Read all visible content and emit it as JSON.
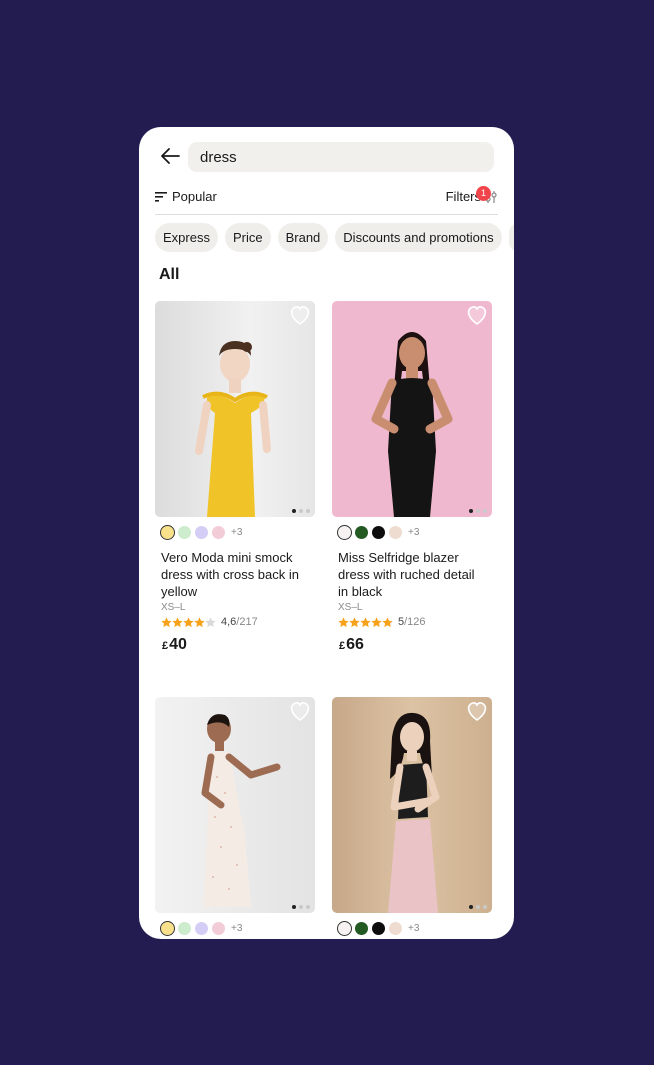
{
  "search": {
    "value": "dress",
    "placeholder": ""
  },
  "toolbar": {
    "sort_label": "Popular",
    "filters_label": "Filters",
    "filters_badge": "1"
  },
  "chips": [
    "Express",
    "Price",
    "Brand",
    "Discounts and promotions"
  ],
  "section_title": "All",
  "colors": {
    "background": "#231c51",
    "accent_star": "#f7a21b",
    "badge": "#f0454a"
  },
  "products": [
    {
      "title": "Vero Moda mini smock dress with cross back in yellow",
      "sizes": "XS–L",
      "rating": "4,6",
      "reviews": "/217",
      "rating_value": 4.6,
      "currency": "£",
      "price": "40",
      "swatches": [
        "#f9e08a",
        "#cdeccd",
        "#d4cdf6",
        "#f2cdd8"
      ],
      "more": "+3",
      "photo": "woman-in-yellow-dress"
    },
    {
      "title": "Miss Selfridge blazer dress with ruched detail in black",
      "sizes": "XS–L",
      "rating": "5",
      "reviews": "/126",
      "rating_value": 5,
      "currency": "£",
      "price": "66",
      "swatches": [
        "#f5f2f1",
        "#225a22",
        "#0d0d0d",
        "#eedcd0"
      ],
      "more": "+3",
      "photo": "woman-in-black-blazer-dress"
    },
    {
      "title": "",
      "sizes": "",
      "rating": "",
      "reviews": "",
      "currency": "",
      "price": "",
      "swatches": [
        "#f9e08a",
        "#cdeccd",
        "#d4cdf6",
        "#f2cdd8"
      ],
      "more": "+3",
      "photo": "woman-in-white-dotted-dress"
    },
    {
      "title": "",
      "sizes": "",
      "rating": "",
      "reviews": "",
      "currency": "",
      "price": "",
      "swatches": [
        "#f5f2f1",
        "#225a22",
        "#0d0d0d",
        "#eedcd0"
      ],
      "more": "+3",
      "photo": "woman-in-pink-skirt"
    }
  ]
}
